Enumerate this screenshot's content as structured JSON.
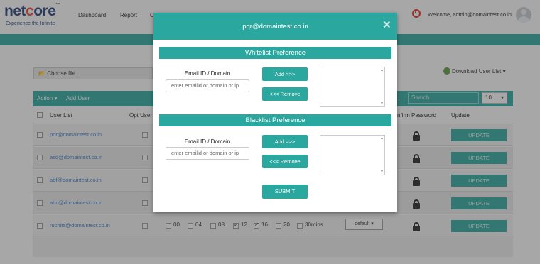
{
  "header": {
    "logo_text_pre": "net",
    "logo_text_o1": "c",
    "logo_text_core": "ore",
    "tagline": "Experience the Infinite",
    "nav": [
      "Dashboard",
      "Report",
      "C"
    ],
    "welcome": "Welcome, admin@domaintest.co.in",
    "brand_color": "#2aa89f"
  },
  "background": {
    "choose_file_label": "Choose file",
    "download_label": "Download User List",
    "toolbar": {
      "action_label": "Action",
      "add_user_label": "Add User"
    },
    "search_placeholder": "Search",
    "per_page_value": "10",
    "columns": [
      "User List",
      "Opt User",
      "nfirm Password",
      "Update"
    ],
    "rows": [
      {
        "email": "pqr@domaintest.co.in",
        "update_label": "UPDATE"
      },
      {
        "email": "asd@domaintest.co.in",
        "update_label": "UPDATE"
      },
      {
        "email": "abf@domaintest.co.in",
        "update_label": "UPDATE"
      },
      {
        "email": "abc@domaintest.co.in",
        "update_label": "UPDATE"
      },
      {
        "email": "ruchita@domaintest.co.in",
        "update_label": "UPDATE"
      }
    ],
    "time_options": [
      {
        "label": "00",
        "checked": false
      },
      {
        "label": "04",
        "checked": false
      },
      {
        "label": "08",
        "checked": false
      },
      {
        "label": "12",
        "checked": true
      },
      {
        "label": "16",
        "checked": true
      },
      {
        "label": "20",
        "checked": false
      },
      {
        "label": "30mins",
        "checked": false
      }
    ],
    "default_label": "default"
  },
  "modal": {
    "title": "pqr@domaintest.co.in",
    "close_icon": "close-icon",
    "whitelist": {
      "heading": "Whitelist Preference",
      "field_label": "Email ID / Domain",
      "placeholder": "enter emailid or domain or ip",
      "add_label": "Add >>>",
      "remove_label": "<<< Remove"
    },
    "blacklist": {
      "heading": "Blacklist Preference",
      "field_label": "Email ID / Domain",
      "placeholder": "enter emailid or domain or ip",
      "add_label": "Add >>>",
      "remove_label": "<<< Remove"
    },
    "submit_label": "SUBMIT"
  }
}
